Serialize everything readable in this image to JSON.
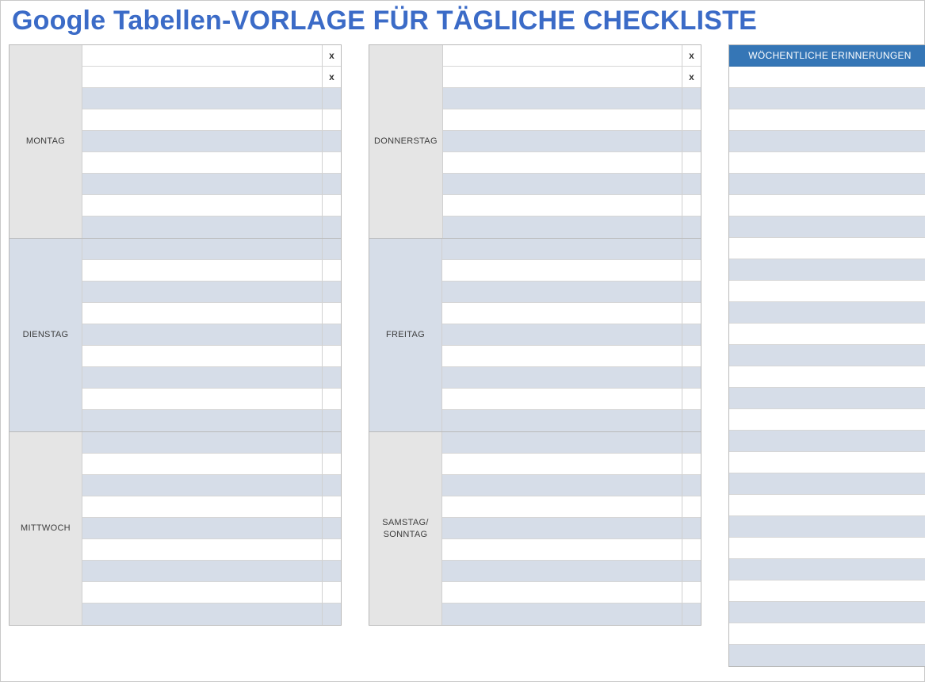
{
  "title": "Google Tabellen-VORLAGE FÜR TÄGLICHE CHECKLISTE",
  "columns": [
    {
      "days": [
        {
          "label": "MONTAG",
          "alt": false,
          "rows": [
            {
              "task": "",
              "check": "x",
              "shaded": false
            },
            {
              "task": "",
              "check": "x",
              "shaded": false
            },
            {
              "task": "",
              "check": "",
              "shaded": true
            },
            {
              "task": "",
              "check": "",
              "shaded": false
            },
            {
              "task": "",
              "check": "",
              "shaded": true
            },
            {
              "task": "",
              "check": "",
              "shaded": false
            },
            {
              "task": "",
              "check": "",
              "shaded": true
            },
            {
              "task": "",
              "check": "",
              "shaded": false
            },
            {
              "task": "",
              "check": "",
              "shaded": true
            }
          ]
        },
        {
          "label": "DIENSTAG",
          "alt": true,
          "rows": [
            {
              "task": "",
              "check": "",
              "shaded": true
            },
            {
              "task": "",
              "check": "",
              "shaded": false
            },
            {
              "task": "",
              "check": "",
              "shaded": true
            },
            {
              "task": "",
              "check": "",
              "shaded": false
            },
            {
              "task": "",
              "check": "",
              "shaded": true
            },
            {
              "task": "",
              "check": "",
              "shaded": false
            },
            {
              "task": "",
              "check": "",
              "shaded": true
            },
            {
              "task": "",
              "check": "",
              "shaded": false
            },
            {
              "task": "",
              "check": "",
              "shaded": true
            }
          ]
        },
        {
          "label": "MITTWOCH",
          "alt": false,
          "rows": [
            {
              "task": "",
              "check": "",
              "shaded": true
            },
            {
              "task": "",
              "check": "",
              "shaded": false
            },
            {
              "task": "",
              "check": "",
              "shaded": true
            },
            {
              "task": "",
              "check": "",
              "shaded": false
            },
            {
              "task": "",
              "check": "",
              "shaded": true
            },
            {
              "task": "",
              "check": "",
              "shaded": false
            },
            {
              "task": "",
              "check": "",
              "shaded": true
            },
            {
              "task": "",
              "check": "",
              "shaded": false
            },
            {
              "task": "",
              "check": "",
              "shaded": true
            }
          ]
        }
      ]
    },
    {
      "days": [
        {
          "label": "DONNERSTAG",
          "alt": false,
          "rows": [
            {
              "task": "",
              "check": "x",
              "shaded": false
            },
            {
              "task": "",
              "check": "x",
              "shaded": false
            },
            {
              "task": "",
              "check": "",
              "shaded": true
            },
            {
              "task": "",
              "check": "",
              "shaded": false
            },
            {
              "task": "",
              "check": "",
              "shaded": true
            },
            {
              "task": "",
              "check": "",
              "shaded": false
            },
            {
              "task": "",
              "check": "",
              "shaded": true
            },
            {
              "task": "",
              "check": "",
              "shaded": false
            },
            {
              "task": "",
              "check": "",
              "shaded": true
            }
          ]
        },
        {
          "label": "FREITAG",
          "alt": true,
          "rows": [
            {
              "task": "",
              "check": "",
              "shaded": true
            },
            {
              "task": "",
              "check": "",
              "shaded": false
            },
            {
              "task": "",
              "check": "",
              "shaded": true
            },
            {
              "task": "",
              "check": "",
              "shaded": false
            },
            {
              "task": "",
              "check": "",
              "shaded": true
            },
            {
              "task": "",
              "check": "",
              "shaded": false
            },
            {
              "task": "",
              "check": "",
              "shaded": true
            },
            {
              "task": "",
              "check": "",
              "shaded": false
            },
            {
              "task": "",
              "check": "",
              "shaded": true
            }
          ]
        },
        {
          "label": "SAMSTAG/ SONNTAG",
          "alt": false,
          "rows": [
            {
              "task": "",
              "check": "",
              "shaded": true
            },
            {
              "task": "",
              "check": "",
              "shaded": false
            },
            {
              "task": "",
              "check": "",
              "shaded": true
            },
            {
              "task": "",
              "check": "",
              "shaded": false
            },
            {
              "task": "",
              "check": "",
              "shaded": true
            },
            {
              "task": "",
              "check": "",
              "shaded": false
            },
            {
              "task": "",
              "check": "",
              "shaded": true
            },
            {
              "task": "",
              "check": "",
              "shaded": false
            },
            {
              "task": "",
              "check": "",
              "shaded": true
            }
          ]
        }
      ]
    }
  ],
  "reminders": {
    "header": "WÖCHENTLICHE ERINNERUNGEN",
    "rows": [
      {
        "text": "",
        "shaded": false
      },
      {
        "text": "",
        "shaded": true
      },
      {
        "text": "",
        "shaded": false
      },
      {
        "text": "",
        "shaded": true
      },
      {
        "text": "",
        "shaded": false
      },
      {
        "text": "",
        "shaded": true
      },
      {
        "text": "",
        "shaded": false
      },
      {
        "text": "",
        "shaded": true
      },
      {
        "text": "",
        "shaded": false
      },
      {
        "text": "",
        "shaded": true
      },
      {
        "text": "",
        "shaded": false
      },
      {
        "text": "",
        "shaded": true
      },
      {
        "text": "",
        "shaded": false
      },
      {
        "text": "",
        "shaded": true
      },
      {
        "text": "",
        "shaded": false
      },
      {
        "text": "",
        "shaded": true
      },
      {
        "text": "",
        "shaded": false
      },
      {
        "text": "",
        "shaded": true
      },
      {
        "text": "",
        "shaded": false
      },
      {
        "text": "",
        "shaded": true
      },
      {
        "text": "",
        "shaded": false
      },
      {
        "text": "",
        "shaded": true
      },
      {
        "text": "",
        "shaded": false
      },
      {
        "text": "",
        "shaded": true
      },
      {
        "text": "",
        "shaded": false
      },
      {
        "text": "",
        "shaded": true
      },
      {
        "text": "",
        "shaded": false
      },
      {
        "text": "",
        "shaded": true
      }
    ]
  }
}
